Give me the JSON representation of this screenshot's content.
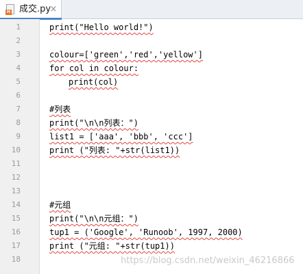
{
  "tab": {
    "title": "成交.py",
    "close": "×",
    "badge": "H"
  },
  "lines": [
    {
      "n": "1",
      "code": "print(\"Hello world!\")",
      "indent": false
    },
    {
      "n": "2",
      "code": "",
      "indent": false
    },
    {
      "n": "3",
      "code": "colour=['green','red','yellow']",
      "indent": false
    },
    {
      "n": "4",
      "code": "for col in colour:",
      "indent": false
    },
    {
      "n": "5",
      "code": "print(col)",
      "indent": true
    },
    {
      "n": "6",
      "code": "",
      "indent": false
    },
    {
      "n": "7",
      "code": "#列表",
      "indent": false
    },
    {
      "n": "8",
      "code": "print(\"\\n\\n列表：\")",
      "indent": false
    },
    {
      "n": "9",
      "code": "list1 = ['aaa', 'bbb', 'ccc']",
      "indent": false
    },
    {
      "n": "10",
      "code": "print (\"列表: \"+str(list1))",
      "indent": false
    },
    {
      "n": "11",
      "code": "",
      "indent": false
    },
    {
      "n": "12",
      "code": "",
      "indent": false
    },
    {
      "n": "13",
      "code": "",
      "indent": false
    },
    {
      "n": "14",
      "code": "#元组",
      "indent": false
    },
    {
      "n": "15",
      "code": "print(\"\\n\\n元组：\")",
      "indent": false
    },
    {
      "n": "16",
      "code": "tup1 = ('Google', 'Runoob', 1997, 2000)",
      "indent": false
    },
    {
      "n": "17",
      "code": "print (\"元组: \"+str(tup1))",
      "indent": false
    },
    {
      "n": "18",
      "code": "",
      "indent": false
    }
  ],
  "watermark": "https://blog.csdn.net/weixin_46216866",
  "colors": {
    "tab_accent": "#4a86c8",
    "squiggle": "#e0453c",
    "gutter": "#f0f0f0"
  }
}
